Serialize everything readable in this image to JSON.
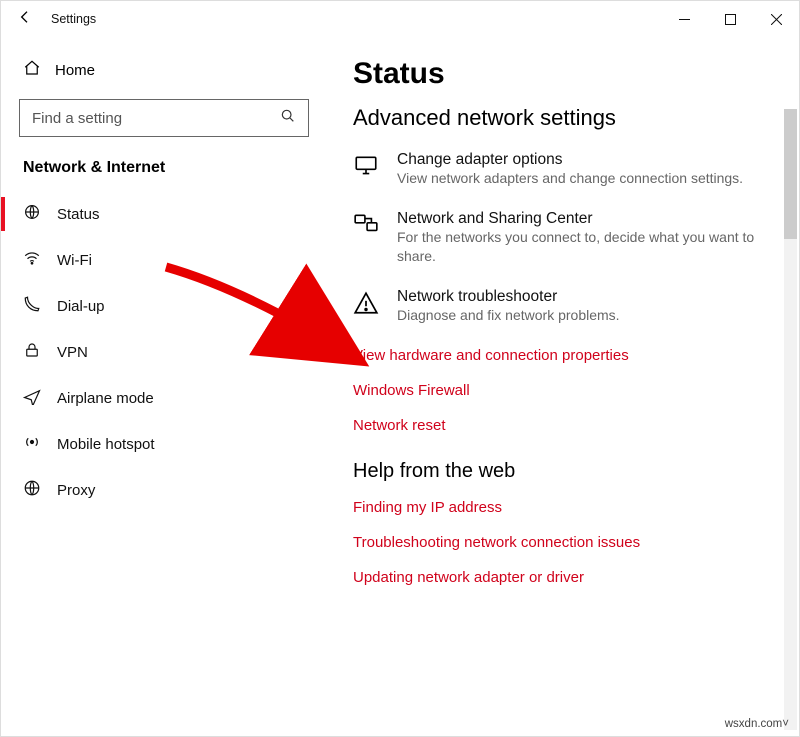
{
  "window": {
    "app_title": "Settings"
  },
  "sidebar": {
    "home": "Home",
    "search_placeholder": "Find a setting",
    "section": "Network & Internet",
    "items": [
      {
        "icon": "status",
        "label": "Status",
        "active": true
      },
      {
        "icon": "wifi",
        "label": "Wi-Fi"
      },
      {
        "icon": "dialup",
        "label": "Dial-up"
      },
      {
        "icon": "vpn",
        "label": "VPN"
      },
      {
        "icon": "airplane",
        "label": "Airplane mode"
      },
      {
        "icon": "hotspot",
        "label": "Mobile hotspot"
      },
      {
        "icon": "proxy",
        "label": "Proxy"
      }
    ]
  },
  "main": {
    "title": "Status",
    "subtitle": "Advanced network settings",
    "settings": [
      {
        "title": "Change adapter options",
        "sub": "View network adapters and change connection settings."
      },
      {
        "title": "Network and Sharing Center",
        "sub": "For the networks you connect to, decide what you want to share."
      },
      {
        "title": "Network troubleshooter",
        "sub": "Diagnose and fix network problems."
      }
    ],
    "links": [
      "View hardware and connection properties",
      "Windows Firewall",
      "Network reset"
    ],
    "help_heading": "Help from the web",
    "help_links": [
      "Finding my IP address",
      "Troubleshooting network connection issues",
      "Updating network adapter or driver"
    ]
  },
  "watermark": "wsxdn.com"
}
